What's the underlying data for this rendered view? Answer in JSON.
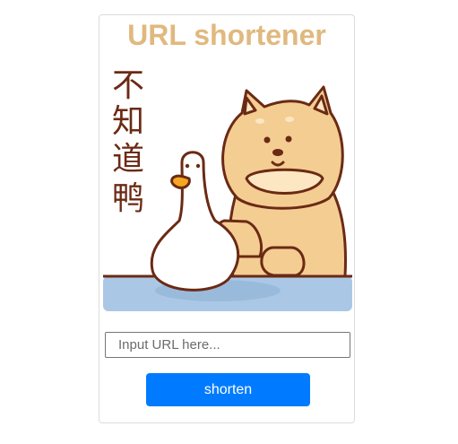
{
  "page": {
    "title": "URL shortener",
    "colors": {
      "title": "#e0b97f",
      "button": "#007bff",
      "dog_fur": "#f4cd93",
      "outline": "#6b2a14",
      "table": "#aac8e6"
    }
  },
  "illustration": {
    "icon": "shiba-and-duck-sticker",
    "caption_chars": [
      "不",
      "知",
      "道",
      "鸭"
    ]
  },
  "form": {
    "url_placeholder": "Input URL here...",
    "url_value": "",
    "shorten_label": "shorten"
  }
}
